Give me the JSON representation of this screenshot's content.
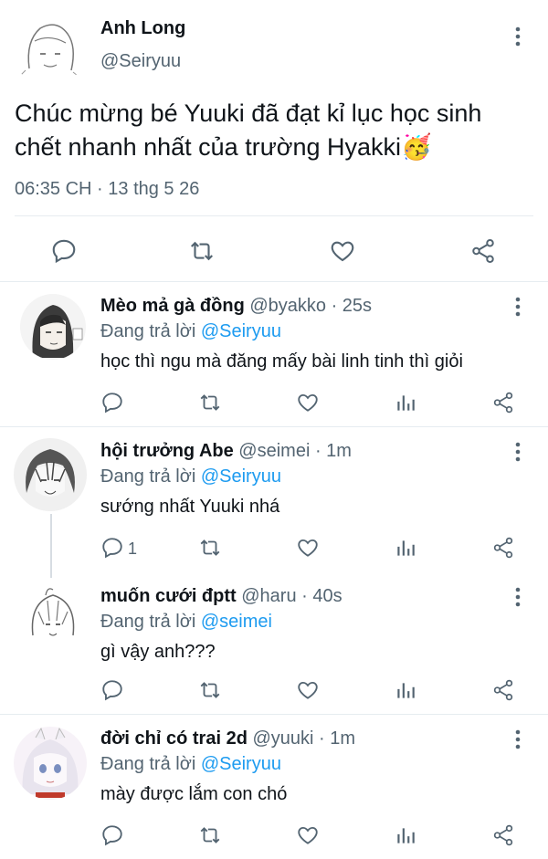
{
  "main_tweet": {
    "display_name": "Anh Long",
    "handle": "@Seiryuu",
    "text_line1": "Chúc mừng bé Yuuki đã đạt kỉ lục học sinh",
    "text_line2": "chết nhanh nhất của trường Hyakki",
    "emoji": "🥳",
    "timestamp": "06:35 CH · 13 thg 5 26"
  },
  "replies": [
    {
      "display_name": "Mèo mả gà đồng",
      "handle_time": "@byakko · 25s",
      "replying_prefix": "Đang trả lời",
      "replying_to": "@Seiryuu",
      "text": "học thì ngu mà đăng mấy bài linh tinh thì giỏi",
      "reply_count": ""
    },
    {
      "display_name": "hội trưởng Abe",
      "handle_time": "@seimei · 1m",
      "replying_prefix": "Đang trả lời",
      "replying_to": "@Seiryuu",
      "text": "sướng nhất Yuuki nhá",
      "reply_count": "1"
    },
    {
      "display_name": "muốn cưới đptt",
      "handle_time": "@haru · 40s",
      "replying_prefix": "Đang trả lời",
      "replying_to": "@seimei",
      "text": "gì vậy anh???",
      "reply_count": ""
    },
    {
      "display_name": "đời chỉ có trai 2d",
      "handle_time": "@yuuki · 1m",
      "replying_prefix": "Đang trả lời",
      "replying_to": "@Seiryuu",
      "text": "mày được lắm con chó",
      "reply_count": ""
    }
  ],
  "icons": {
    "reply": "reply-icon",
    "retweet": "retweet-icon",
    "like": "like-icon",
    "analytics": "analytics-icon",
    "share": "share-icon",
    "more": "more-vertical-icon"
  },
  "colors": {
    "text": "#0f1419",
    "secondary": "#536471",
    "accent": "#1d9bf0",
    "divider": "#e6ecf0"
  }
}
